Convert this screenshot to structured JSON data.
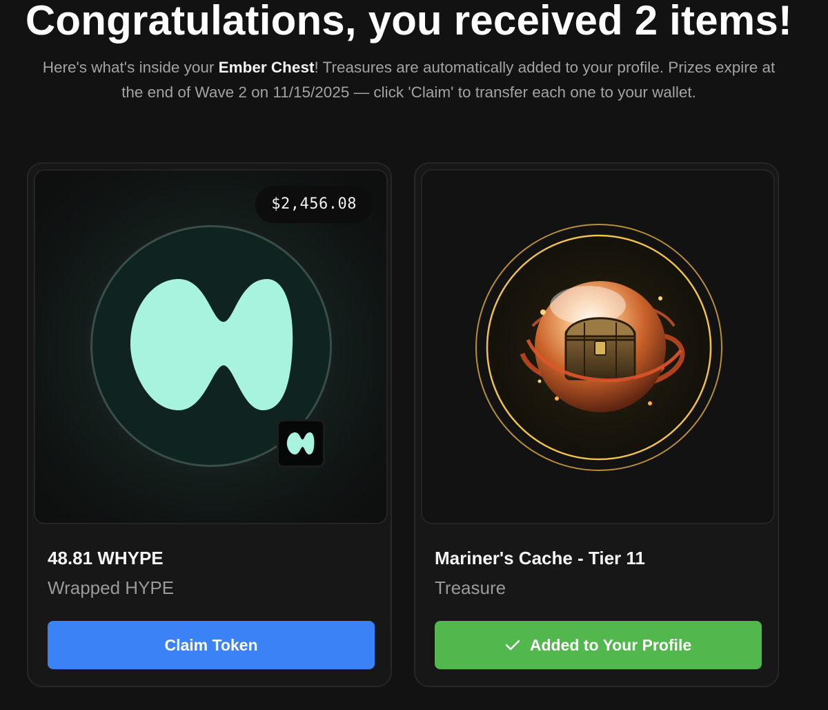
{
  "header": {
    "title": "Congratulations, you received 2 items!",
    "subtitle_part1": "Here's what's inside your ",
    "chest_name": "Ember Chest",
    "subtitle_part2": "! Treasures are automatically added to your profile. Prizes expire at the end of Wave 2 on 11/15/2025 — click 'Claim' to transfer each one to your wallet."
  },
  "items": [
    {
      "price": "$2,456.08",
      "name": "48.81 WHYPE",
      "subtitle": "Wrapped HYPE",
      "action_label": "Claim Token",
      "icon": "hyperliquid-logo-icon",
      "accent_color": "#a8f3de",
      "button_color": "#3b82f6"
    },
    {
      "name": "Mariner's Cache - Tier 11",
      "subtitle": "Treasure",
      "action_label": "Added to Your Profile",
      "action_icon": "check-icon",
      "icon": "treasure-orb-icon",
      "button_color": "#52b84e"
    }
  ]
}
